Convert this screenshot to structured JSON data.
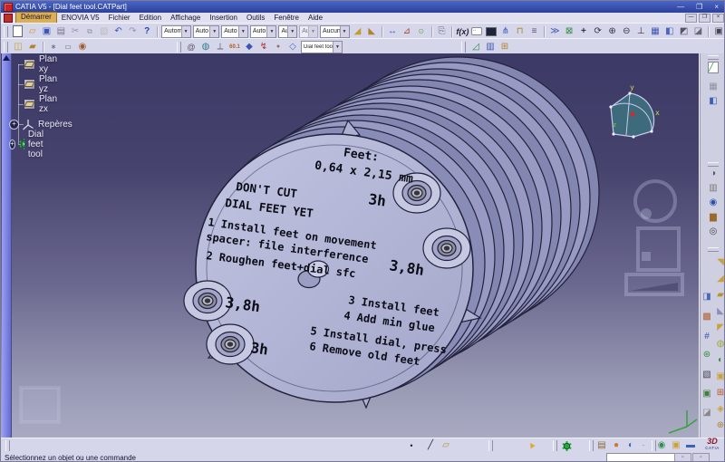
{
  "window": {
    "title": "CATIA V5 - [Dial feet tool.CATPart]"
  },
  "menu": {
    "items": [
      "Démarrer",
      "ENOVIA V5",
      "Fichier",
      "Edition",
      "Affichage",
      "Insertion",
      "Outils",
      "Fenêtre",
      "Aide"
    ]
  },
  "toolbars": {
    "graphic_combos": [
      "Autom",
      "Auto",
      "Auto",
      "Auto",
      "Aut",
      "Aut",
      "Aucun"
    ],
    "tools_combo_value": "Dial feet tool",
    "measure_icon_label": "60.1"
  },
  "tree": {
    "items": [
      {
        "label": "Plan xy"
      },
      {
        "label": "Plan yz"
      },
      {
        "label": "Plan zx"
      },
      {
        "label": "Repères"
      },
      {
        "label": "Dial feet tool"
      }
    ]
  },
  "part_face": {
    "feet_title": "Feet:",
    "feet_size": "0,64 x 2,15 mm",
    "warning_line1": "DON'T CUT",
    "warning_line2": "DIAL FEET YET",
    "step1_line1": "1 Install feet on movement",
    "step1_line2": "spacer: file interference",
    "step2": "2 Roughen feet+dial sfc",
    "step3": "3 Install feet",
    "step4": "4 Add min glue",
    "step5": "5 Install dial, press",
    "step6": "6 Remove old feet",
    "pos_top": "3h",
    "pos_right": "3,8h",
    "pos_left": "3,8h",
    "pos_bottom": "3h"
  },
  "compass": {
    "x": "x",
    "y": "y",
    "z": "z"
  },
  "status": {
    "message": "Sélectionnez un objet ou une commande",
    "command_value": ""
  },
  "brand": {
    "logo_3d": "3D",
    "logo_name": "CATIA"
  },
  "colors": {
    "titlebar": "#2c4099",
    "menu_highlight": "#dcae56",
    "viewport_top": "#3c3966",
    "viewport_bottom": "#a9aac2",
    "part_face": "#b4b6d8",
    "tree_text": "#e9e9f6"
  }
}
